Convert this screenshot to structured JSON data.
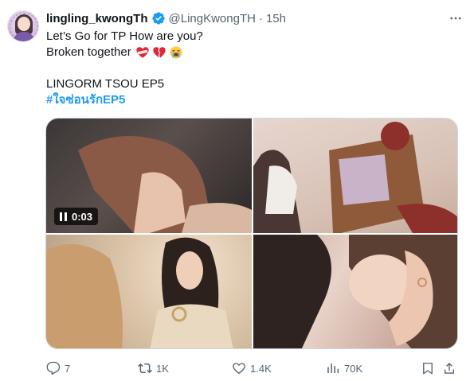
{
  "author": {
    "display_name": "lingling_kwongTh",
    "handle": "@LingKwongTH",
    "separator": "·",
    "time": "15h"
  },
  "tweet": {
    "line1": "Let’s Go for TP How are you?",
    "line2": "Broken together",
    "line3": "LINGORM TSOU EP5",
    "hashtag": "#ใจซ่อนรักEP5"
  },
  "media": {
    "video_duration": "0:03",
    "video_state_icon": "pause-icon"
  },
  "icons": {
    "verified": "verified-badge-icon",
    "more": "more-icon",
    "reply": "reply-icon",
    "repost": "repost-icon",
    "like": "like-icon",
    "views": "views-icon",
    "bookmark": "bookmark-icon",
    "share": "share-icon"
  },
  "engagement": {
    "replies": "7",
    "reposts": "1K",
    "likes": "1.4K",
    "views": "70K"
  },
  "colors": {
    "text": "#0f1419",
    "muted": "#536471",
    "link": "#1d9bf0",
    "border": "#cfd9de"
  }
}
